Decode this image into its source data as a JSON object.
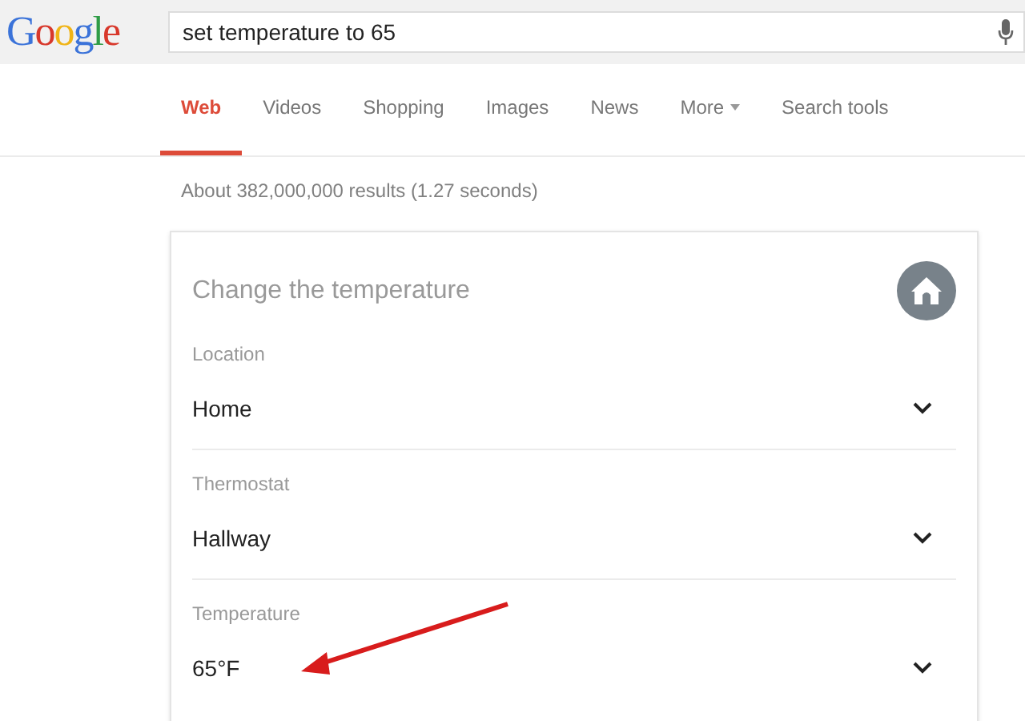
{
  "logo": "Google",
  "search": {
    "value": "set temperature to 65"
  },
  "tabs": [
    {
      "label": "Web",
      "selected": true
    },
    {
      "label": "Videos",
      "selected": false
    },
    {
      "label": "Shopping",
      "selected": false
    },
    {
      "label": "Images",
      "selected": false
    },
    {
      "label": "News",
      "selected": false
    },
    {
      "label": "More",
      "selected": false,
      "kind": "menu"
    },
    {
      "label": "Search tools",
      "selected": false
    }
  ],
  "result_stats": "About 382,000,000 results (1.27 seconds)",
  "card": {
    "title": "Change the temperature",
    "fields": [
      {
        "label": "Location",
        "value": "Home"
      },
      {
        "label": "Thermostat",
        "value": "Hallway"
      },
      {
        "label": "Temperature",
        "value": "65°F"
      }
    ]
  }
}
